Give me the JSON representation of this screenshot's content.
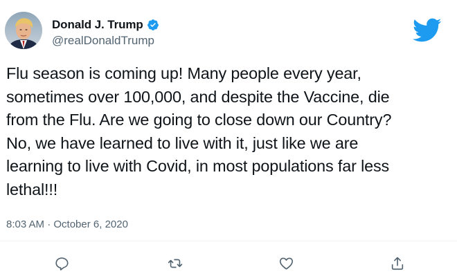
{
  "author": {
    "display_name": "Donald J. Trump",
    "handle": "@realDonaldTrump",
    "verified": true,
    "avatar_icon": "profile-photo"
  },
  "tweet": {
    "text": "Flu season is coming up! Many people every year,\nsometimes over 100,000, and despite the Vaccine, die\nfrom the Flu. Are we going to close down our Country?\nNo, we have learned to live with it, just like we are\nlearning to live with Covid, in most populations far less\nlethal!!!",
    "timestamp": "8:03 AM · October 6, 2020"
  },
  "actions": [
    {
      "name": "reply",
      "icon": "reply-icon"
    },
    {
      "name": "retweet",
      "icon": "retweet-icon"
    },
    {
      "name": "like",
      "icon": "heart-icon"
    },
    {
      "name": "share",
      "icon": "share-icon"
    }
  ],
  "colors": {
    "brand": "#1d9bf0",
    "text": "#0f1419",
    "secondary": "#536471"
  }
}
